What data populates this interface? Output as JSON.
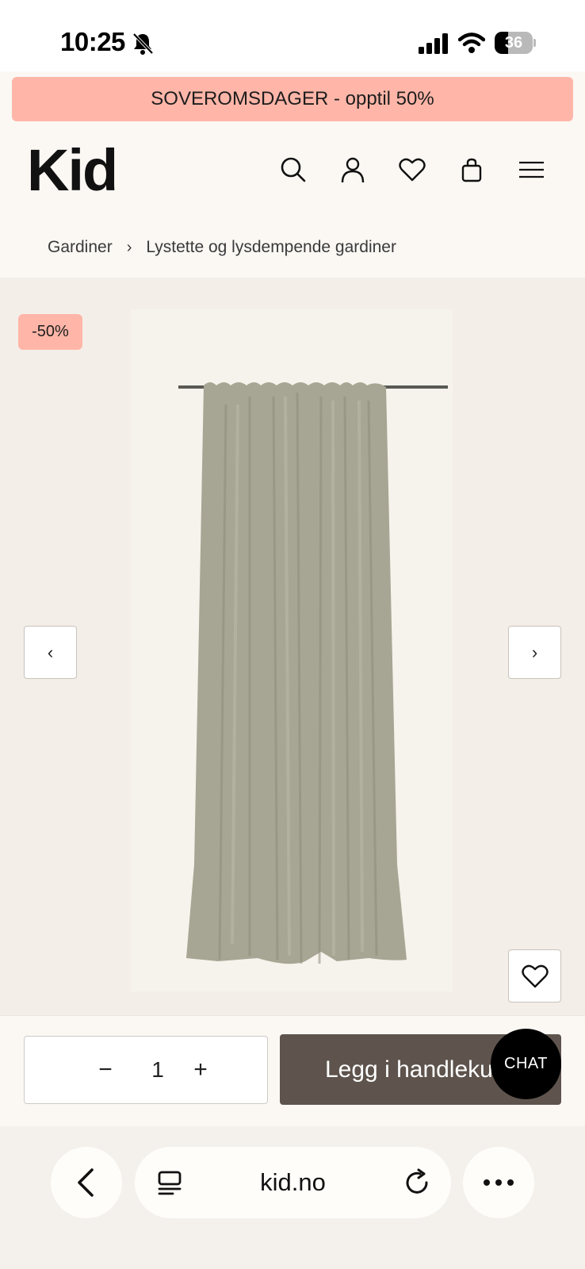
{
  "status_bar": {
    "time": "10:25",
    "battery_level": "36",
    "battery_fraction": 0.36
  },
  "promo": {
    "text": "SOVEROMSDAGER - opptil 50%"
  },
  "header": {
    "logo": "Kid",
    "icons": [
      "search-icon",
      "account-icon",
      "heart-icon",
      "bag-icon",
      "menu-icon"
    ]
  },
  "breadcrumb": {
    "items": [
      "Gardiner",
      "Lystette og lysdempende gardiner"
    ],
    "separator": "›"
  },
  "gallery": {
    "badge": "-50%",
    "prev_label": "‹",
    "next_label": "›"
  },
  "purchase": {
    "quantity": "1",
    "minus_label": "−",
    "plus_label": "+",
    "add_to_cart_label": "Legg i handlekurv",
    "chat_label": "CHAT"
  },
  "browser": {
    "url": "kid.no"
  },
  "colors": {
    "promo": "#ffb6a8",
    "cart_button": "#5e544d",
    "curtain": "#a7a593",
    "page_bg": "#fbf8f4"
  }
}
